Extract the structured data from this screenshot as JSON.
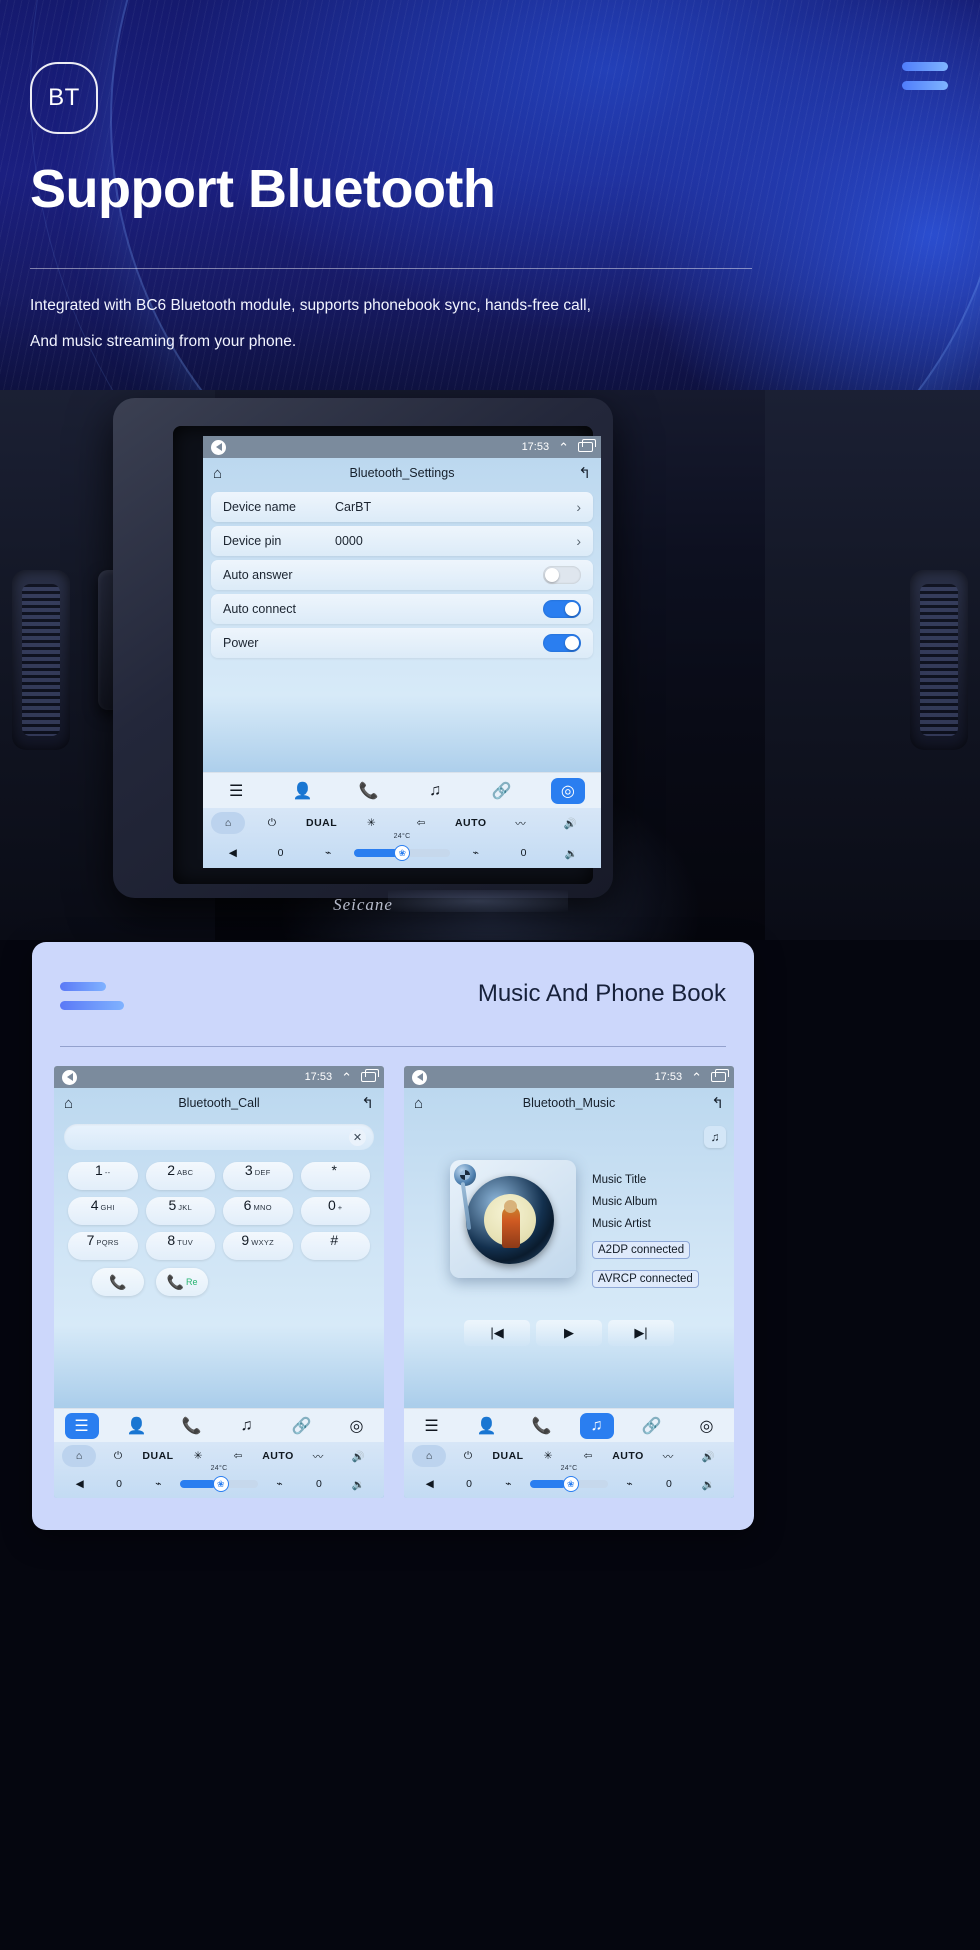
{
  "hero": {
    "badge": "BT",
    "title": "Support Bluetooth",
    "subtitle_line1": "Integrated with BC6 Bluetooth module, supports phonebook sync, hands-free call,",
    "subtitle_line2": "And music streaming from your phone.",
    "accent": "#4f7dfb"
  },
  "car": {
    "brand": "Seicane"
  },
  "settings_screen": {
    "status": {
      "time": "17:53"
    },
    "title": "Bluetooth_Settings",
    "rows": [
      {
        "label": "Device name",
        "value": "CarBT",
        "type": "chevron"
      },
      {
        "label": "Device pin",
        "value": "0000",
        "type": "chevron"
      },
      {
        "label": "Auto answer",
        "value": "",
        "type": "toggle",
        "on": false
      },
      {
        "label": "Auto connect",
        "value": "",
        "type": "toggle",
        "on": true
      },
      {
        "label": "Power",
        "value": "",
        "type": "toggle",
        "on": true
      }
    ],
    "dock": [
      "list-icon",
      "contact-icon",
      "phone-icon",
      "music-icon",
      "link-icon",
      "settings-icon"
    ],
    "dock_active_index": 5,
    "climate": {
      "power": "power-icon",
      "dual": "DUAL",
      "ac": "snowflake-icon",
      "recirc": "recirculate-icon",
      "auto": "AUTO",
      "defrost": "defrost-icon",
      "volume_up": "volume-up-icon",
      "temp": "24°C",
      "left_value": "0",
      "right_value": "0",
      "seat": "seat-icon",
      "heated_seat": "heated-seat-icon",
      "back": "back-arrow-icon",
      "volume_down": "volume-down-icon",
      "fan_percent": 46
    }
  },
  "card": {
    "title": "Music And Phone Book"
  },
  "call_screen": {
    "status": {
      "time": "17:53"
    },
    "title": "Bluetooth_Call",
    "search_value": "",
    "clear_icon": "close-icon",
    "keys": [
      {
        "n": "1",
        "s": "--"
      },
      {
        "n": "2",
        "s": "ABC"
      },
      {
        "n": "3",
        "s": "DEF"
      },
      {
        "n": "*",
        "s": ""
      },
      {
        "n": "4",
        "s": "GHI"
      },
      {
        "n": "5",
        "s": "JKL"
      },
      {
        "n": "6",
        "s": "MNO"
      },
      {
        "n": "0",
        "s": "+"
      },
      {
        "n": "7",
        "s": "PQRS"
      },
      {
        "n": "8",
        "s": "TUV"
      },
      {
        "n": "9",
        "s": "WXYZ"
      },
      {
        "n": "#",
        "s": ""
      }
    ],
    "call_button": "phone-icon",
    "redial_button_label": "Re",
    "dock_active_index": 0,
    "climate": {
      "dual": "DUAL",
      "auto": "AUTO",
      "temp": "24°C",
      "left_value": "0",
      "right_value": "0"
    }
  },
  "music_screen": {
    "status": {
      "time": "17:53"
    },
    "title": "Bluetooth_Music",
    "note_button": "music-icon",
    "meta": {
      "title": "Music Title",
      "album": "Music Album",
      "artist": "Music Artist",
      "a2dp": "A2DP  connected",
      "avrcp": "AVRCP connected"
    },
    "transport": [
      "prev-icon",
      "play-icon",
      "next-icon"
    ],
    "dock_active_index": 3,
    "climate": {
      "dual": "DUAL",
      "auto": "AUTO",
      "temp": "24°C",
      "left_value": "0",
      "right_value": "0"
    }
  },
  "glyphs": {
    "home": "⌂",
    "back_return": "↰",
    "chevron": "›",
    "contact": "👤",
    "phone": "📞",
    "music": "♫",
    "link": "🔗",
    "settings": "◎",
    "list": "☰",
    "power": "⏻",
    "snow": "✳",
    "car": "⇦",
    "defrost": "〰",
    "vol_up": "🔊",
    "vol_down": "🔉",
    "seat": "⌁",
    "prev": "|◀",
    "play": "▶",
    "next": "▶|",
    "close": "✕",
    "caret_up": "⌃"
  }
}
